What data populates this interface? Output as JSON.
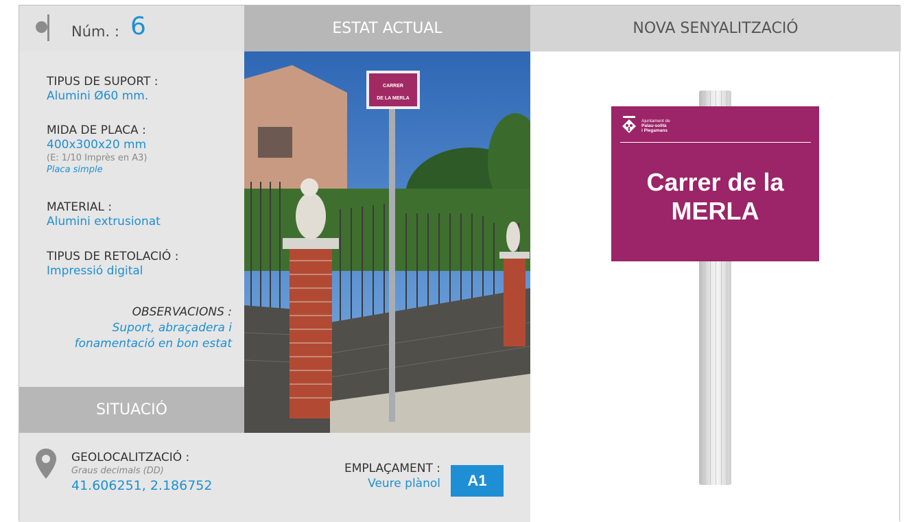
{
  "header": {
    "num_label": "Núm. :",
    "num_value": "6",
    "estat_actual": "ESTAT ACTUAL",
    "nova_senyalitzacio": "NOVA SENYALITZACIÓ"
  },
  "specs": {
    "suport_label": "TIPUS DE SUPORT :",
    "suport_value": "Alumini Ø60 mm.",
    "mida_label": "MIDA DE PLACA :",
    "mida_value": "400x300x20 mm",
    "mida_note": "(E: 1/10 Imprès en A3)",
    "mida_type": "Placa simple",
    "material_label": "MATERIAL :",
    "material_value": "Alumini extrusionat",
    "retolacio_label": "TIPUS DE RETOLACIÓ :",
    "retolacio_value": "Impressió digital",
    "observacions_label": "OBSERVACIONS :",
    "observacions_line1": "Suport, abraçadera i",
    "observacions_line2": "fonamentació en bon estat"
  },
  "situacio": {
    "title": "SITUACIÓ",
    "geo_label": "GEOLOCALITZACIÓ :",
    "geo_note": "Graus decimals (DD)",
    "geo_value": "41.606251, 2.186752",
    "emplacament_label": "EMPLAÇAMENT :",
    "emplacament_link": "Veure plànol",
    "emplacament_badge": "A1"
  },
  "photo": {
    "sign_line1": "CARRER",
    "sign_line2": "DE LA MERLA"
  },
  "new_sign": {
    "logo_line1": "Ajuntament de",
    "logo_line2": "Palau-solità",
    "logo_line3": "i Plegamans",
    "street_line1": "Carrer de la",
    "street_line2": "MERLA"
  },
  "colors": {
    "accent_blue": "#1e8fd4",
    "plate_magenta": "#9c2468",
    "panel_grey": "#e6e6e6",
    "header_grey": "#b7b7b7"
  },
  "icons": {
    "location": "map-pin-icon",
    "logo": "municipal-shield-icon"
  }
}
